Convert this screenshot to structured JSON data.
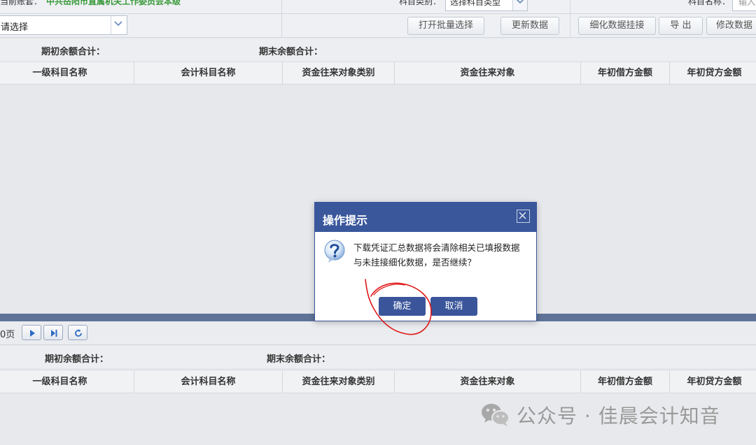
{
  "topbar": {
    "account_label": "当前账套：",
    "account_name": "中共岳阳市直属机关工作委员会本级",
    "subject_type_label": "科目类别：",
    "subject_type_value": "选择科目类型",
    "subject_name_label": "科目名称：",
    "subject_name_placeholder": "输入"
  },
  "toolbar": {
    "select_value": "请选择",
    "buttons": {
      "batch_select": "打开批量选择",
      "refresh": "更新数据",
      "detail_link": "细化数据挂接",
      "export": "导 出",
      "modify": "修改数据"
    }
  },
  "summary": {
    "opening_total_label": "期初余额合计：",
    "closing_total_label": "期末余额合计："
  },
  "table": {
    "columns": [
      "一级科目名称",
      "会计科目名称",
      "资金往来对象类别",
      "资金往来对象",
      "年初借方金额",
      "年初贷方金额"
    ]
  },
  "pager": {
    "page_text": "0页"
  },
  "dialog": {
    "title": "操作提示",
    "message_line1": "下载凭证汇总数据将会清除相关已填报数据",
    "message_line2": "与未挂接细化数据，是否继续？",
    "confirm_label": "确定",
    "cancel_label": "取消"
  },
  "watermark": {
    "text": "公众号 · 佳晨会计知音"
  },
  "colors": {
    "dialog_header": "#3a579c",
    "account_name": "#3a9a3a",
    "annotation_circle": "#e01818"
  }
}
